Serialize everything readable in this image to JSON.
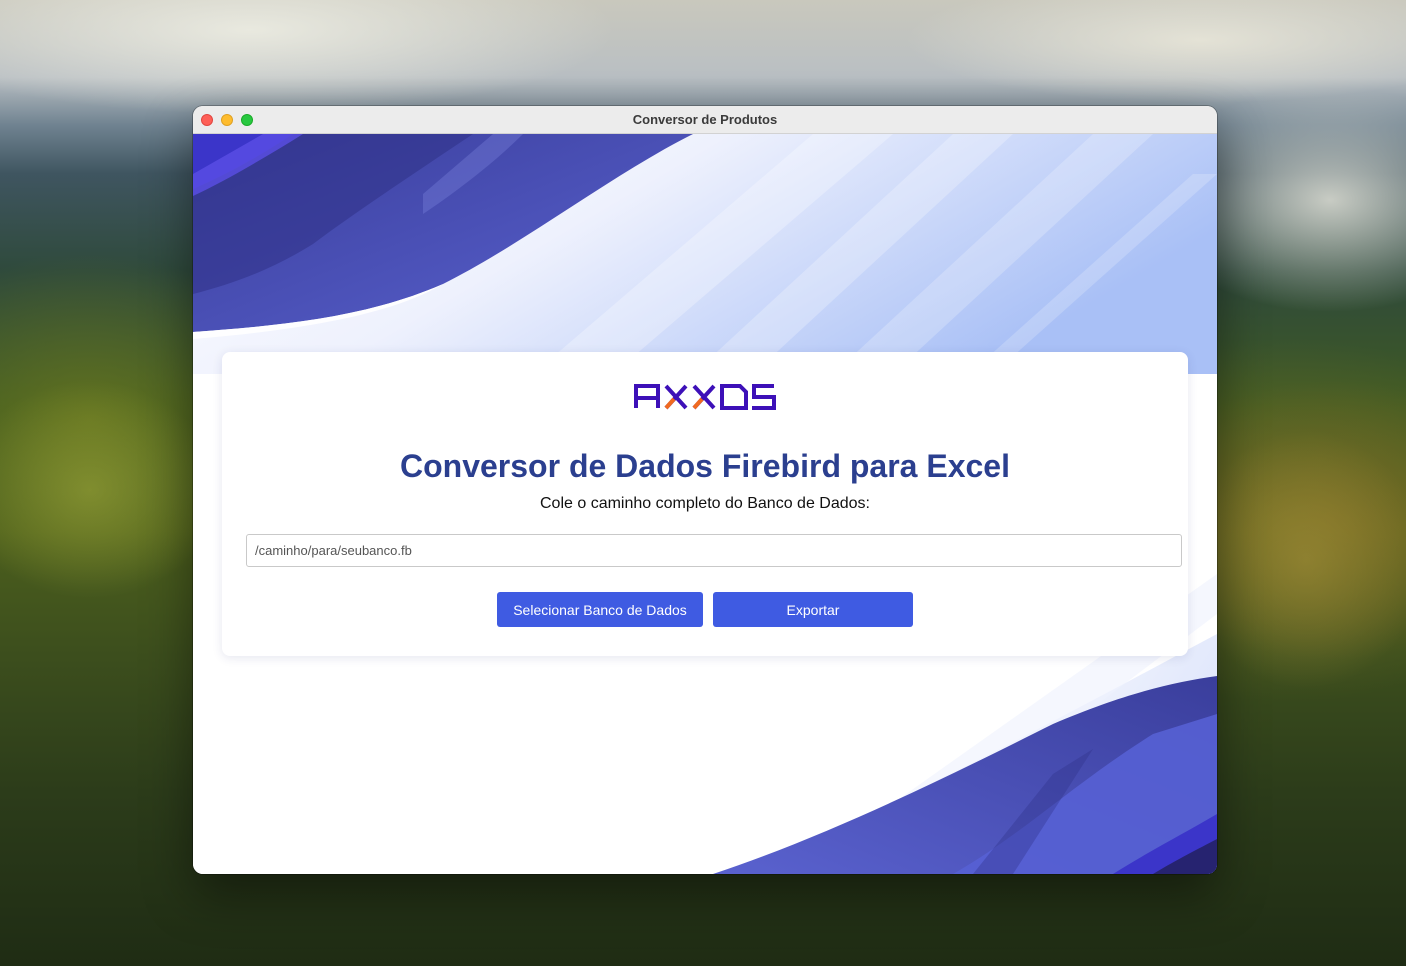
{
  "window": {
    "title": "Conversor de Produtos"
  },
  "brand": {
    "logo_text": "AXXOS",
    "logo_color": "#3d10b8",
    "logo_accent": "#f06a20"
  },
  "main": {
    "heading": "Conversor de Dados Firebird para Excel",
    "subheading": "Cole o caminho completo do Banco de Dados:",
    "path_input": {
      "value": "",
      "placeholder": "/caminho/para/seubanco.fb"
    },
    "buttons": {
      "select_label": "Selecionar Banco de Dados",
      "export_label": "Exportar"
    }
  },
  "colors": {
    "heading": "#2b3f8f",
    "button": "#3f5be2",
    "wave_dark": "#2a2a7a",
    "wave_mid": "#4a4fc0"
  }
}
